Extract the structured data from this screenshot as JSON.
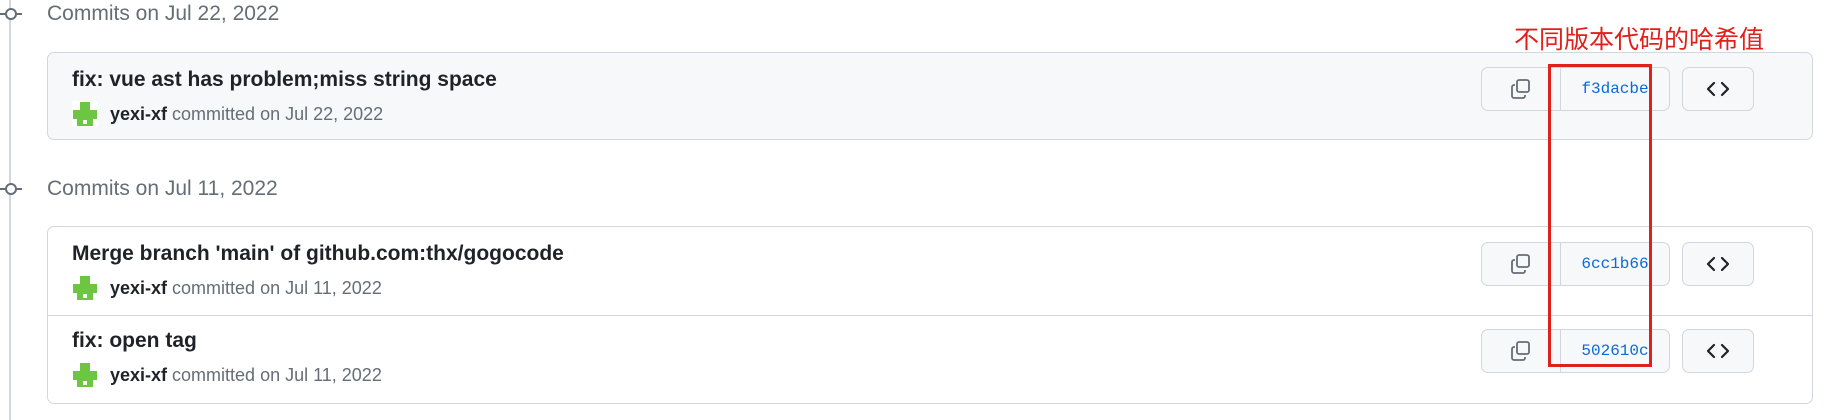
{
  "groups": [
    {
      "title": "Commits on Jul 22, 2022",
      "commits": [
        {
          "message": "fix: vue ast has problem;miss string space",
          "author": "yexi-xf",
          "committed_text": "committed on Jul 22, 2022",
          "sha": "f3dacbe"
        }
      ]
    },
    {
      "title": "Commits on Jul 11, 2022",
      "commits": [
        {
          "message": "Merge branch 'main' of github.com:thx/gogocode",
          "author": "yexi-xf",
          "committed_text": "committed on Jul 11, 2022",
          "sha": "6cc1b66"
        },
        {
          "message": "fix: open tag",
          "author": "yexi-xf",
          "committed_text": "committed on Jul 11, 2022",
          "sha": "502610c"
        }
      ]
    }
  ],
  "annotation": {
    "text": "不同版本代码的哈希值",
    "color": "#e0201b"
  },
  "colors": {
    "sha_link": "#0969da",
    "avatar": "#6cc644",
    "border": "#d0d7de",
    "muted_text": "#656d76"
  },
  "icons": {
    "copy": "copy-icon",
    "browse": "code-icon",
    "timeline": "git-commit-icon"
  }
}
